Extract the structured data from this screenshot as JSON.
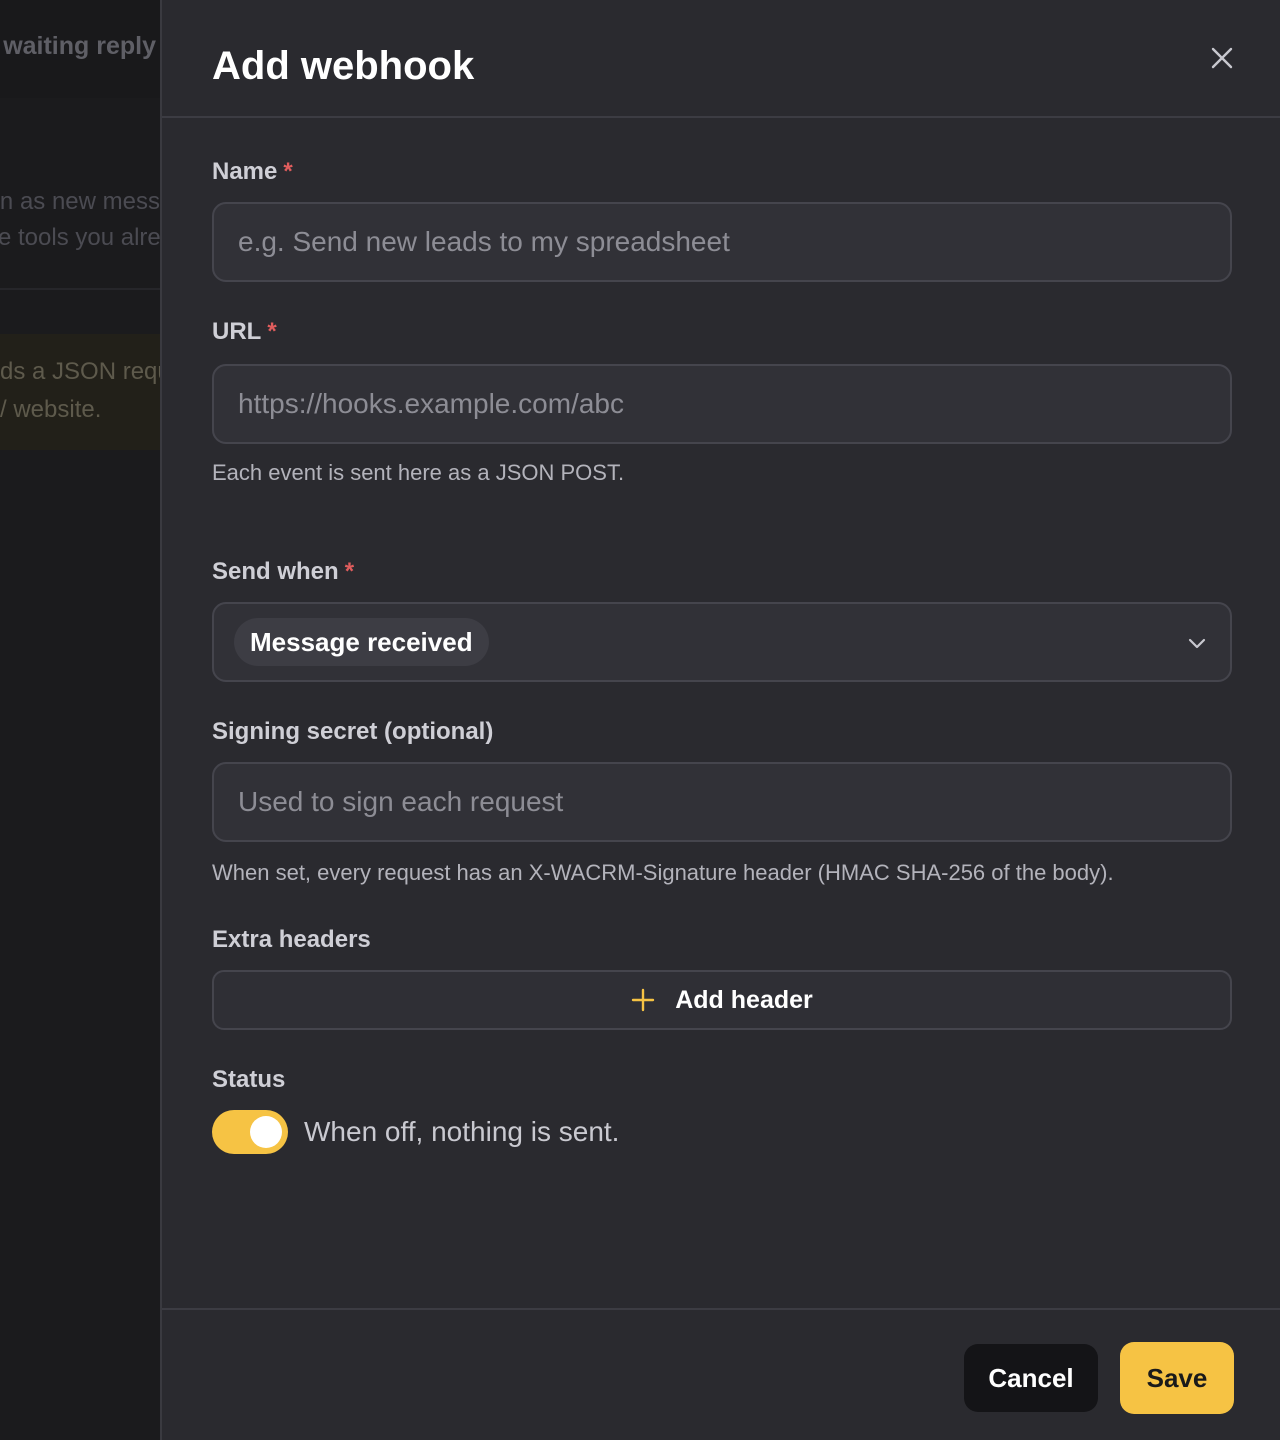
{
  "background": {
    "line1": "waiting reply",
    "line2": "n as new mess",
    "line3": "e tools you alre",
    "note_line1": "ds a JSON requ",
    "note_line2": "/ website."
  },
  "dialog": {
    "title": "Add webhook",
    "close_icon": "close-icon"
  },
  "form": {
    "name": {
      "label": "Name",
      "required_mark": "*",
      "value": "",
      "placeholder": "e.g. Send new leads to my spreadsheet"
    },
    "url": {
      "label": "URL",
      "required_mark": "*",
      "value": "",
      "placeholder": "https://hooks.example.com/abc",
      "help": "Each event is sent here as a JSON POST."
    },
    "send_when": {
      "label": "Send when",
      "required_mark": "*",
      "selected": "Message received",
      "icon": "chevron-down-icon"
    },
    "signing_secret": {
      "label": "Signing secret (optional)",
      "value": "",
      "placeholder": "Used to sign each request",
      "help": "When set, every request has an X-WACRM-Signature header (HMAC SHA-256 of the body)."
    },
    "extra_headers": {
      "label": "Extra headers",
      "add_button_label": "Add header",
      "icon": "plus-icon"
    },
    "status": {
      "label": "Status",
      "enabled": true,
      "description": "When off, nothing is sent."
    }
  },
  "footer": {
    "cancel_label": "Cancel",
    "save_label": "Save"
  },
  "colors": {
    "accent": "#f6c344",
    "required": "#e05d5d",
    "panel_bg": "#2a2a2f"
  }
}
